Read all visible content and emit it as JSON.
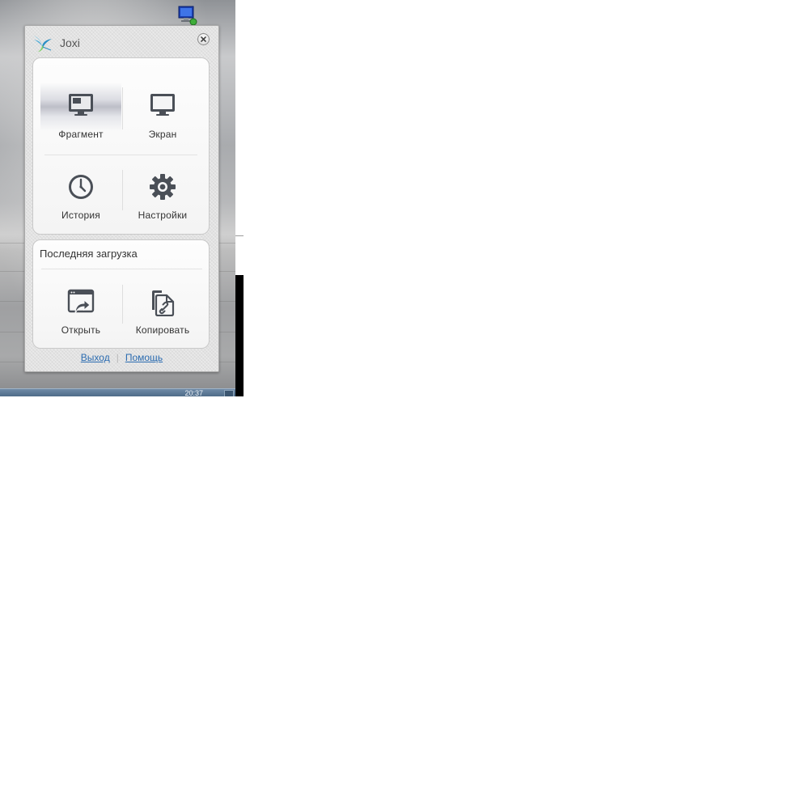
{
  "app": {
    "title": "Joxi"
  },
  "main_actions": {
    "fragment": {
      "label": "Фрагмент",
      "icon": "monitor-fragment-icon"
    },
    "screen": {
      "label": "Экран",
      "icon": "monitor-icon"
    },
    "history": {
      "label": "История",
      "icon": "clock-icon"
    },
    "settings": {
      "label": "Настройки",
      "icon": "gear-icon"
    }
  },
  "last_upload": {
    "title": "Последняя загрузка",
    "open": {
      "label": "Открыть",
      "icon": "open-window-icon"
    },
    "copy": {
      "label": "Копировать",
      "icon": "copy-link-icon"
    }
  },
  "footer": {
    "exit_label": "Выход",
    "help_label": "Помощь"
  },
  "taskbar": {
    "clock": "20:37"
  },
  "colors": {
    "link": "#2a6bb0",
    "icon": "#4a4f57",
    "accent_bird": "#29a7d8"
  }
}
